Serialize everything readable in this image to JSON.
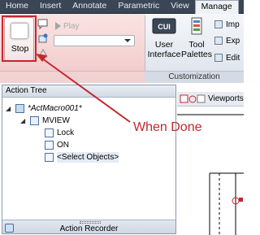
{
  "tabs": [
    "Home",
    "Insert",
    "Annotate",
    "Parametric",
    "View",
    "Manage"
  ],
  "active_tab": "Manage",
  "ribbon": {
    "stop_label": "Stop",
    "play_label": "Play",
    "combo_value": "",
    "customization": {
      "cui_label": "User\nInterface",
      "cui_badge": "CUI",
      "tool_palettes_label": "Tool\nPalettes",
      "panel_title": "Customization",
      "small_buttons": [
        "Imp",
        "Exp",
        "Edit"
      ]
    }
  },
  "viewports_label": "Viewports",
  "action_tree": {
    "title": "Action Tree",
    "items": [
      {
        "label": "*ActMacro001*",
        "level": 0,
        "italic": true
      },
      {
        "label": "MVIEW",
        "level": 1
      },
      {
        "label": "Lock",
        "level": 2
      },
      {
        "label": "ON",
        "level": 2
      },
      {
        "label": "<Select Objects>",
        "level": 2
      }
    ],
    "footer_label": "Action Recorder"
  },
  "annotation": {
    "text": "When Done",
    "color": "#c6262e"
  },
  "icons": [
    "stop-icon",
    "play-icon",
    "cui-icon",
    "tool-palettes-icon",
    "macro-icon",
    "command-icon",
    "value-icon",
    "action-recorder-icon"
  ]
}
